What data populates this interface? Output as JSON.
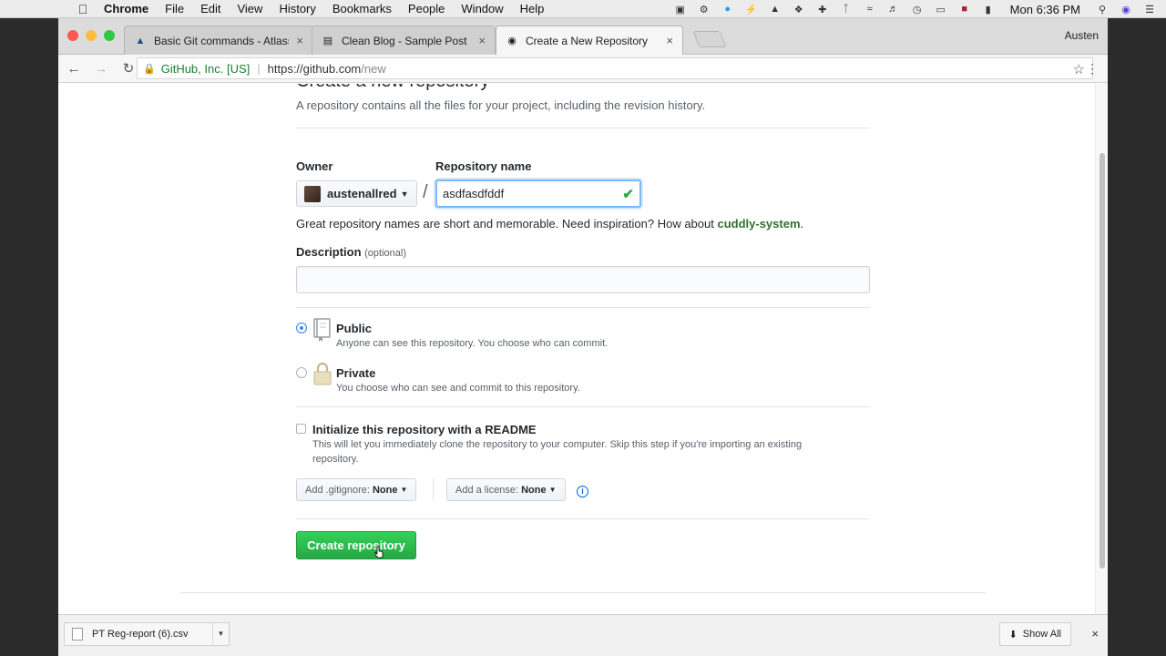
{
  "menubar": {
    "app": "Chrome",
    "items": [
      "File",
      "Edit",
      "View",
      "History",
      "Bookmarks",
      "People",
      "Window",
      "Help"
    ],
    "clock": "Mon 6:36 PM"
  },
  "browser": {
    "tabs": [
      {
        "title": "Basic Git commands - Atlassia",
        "icon": "atlassian-icon"
      },
      {
        "title": "Clean Blog - Sample Post",
        "icon": "document-icon"
      },
      {
        "title": "Create a New Repository",
        "icon": "github-icon"
      }
    ],
    "profile": "Austen",
    "omnibox": {
      "secure_label": "GitHub, Inc. [US]",
      "url_host": "https://github.com",
      "url_path": "/new"
    }
  },
  "page": {
    "title": "Create a new repository",
    "subtitle": "A repository contains all the files for your project, including the revision history.",
    "owner_label": "Owner",
    "owner_value": "austenallred",
    "slash": "/",
    "repo_label": "Repository name",
    "repo_value": "asdfasdfddf",
    "hint_prefix": "Great repository names are short and memorable. Need inspiration? How about ",
    "hint_suggestion": "cuddly-system",
    "hint_suffix": ".",
    "description_label": "Description",
    "description_optional": "(optional)",
    "description_value": "",
    "visibility": {
      "selected": "public",
      "public_label": "Public",
      "public_note": "Anyone can see this repository. You choose who can commit.",
      "private_label": "Private",
      "private_note": "You choose who can see and commit to this repository."
    },
    "readme": {
      "checked": false,
      "label": "Initialize this repository with a README",
      "note_line1": "This will let you immediately clone the repository to your computer. Skip this step if you're importing an existing",
      "note_line2": "repository."
    },
    "gitignore": {
      "prefix": "Add .gitignore:",
      "value": "None"
    },
    "license": {
      "prefix": "Add a license:",
      "value": "None"
    },
    "info_glyph": "i",
    "create_button": "Create repository"
  },
  "downloads": {
    "file": "PT Reg-report (6).csv",
    "show_all": "Show All"
  },
  "colors": {
    "accent_green": "#28a745",
    "focus_blue": "#79b8ff",
    "radio_blue": "#3b8beb"
  }
}
